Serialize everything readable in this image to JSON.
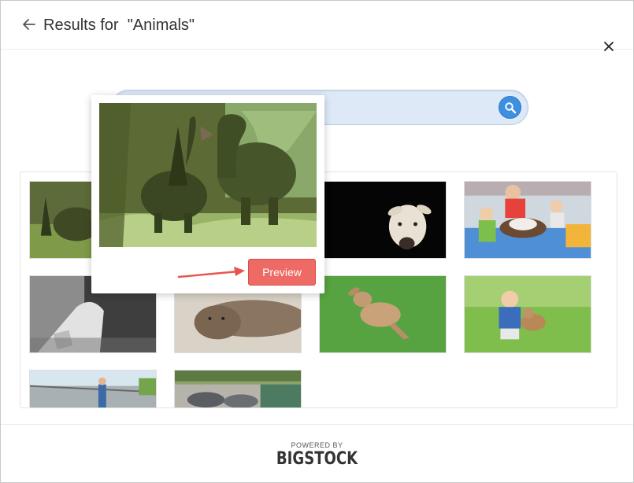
{
  "header": {
    "title": "Results for  \"Animals\"",
    "back_icon": "back-arrow-icon",
    "close_icon": "close-icon"
  },
  "search": {
    "value": "",
    "button_icon": "search-icon"
  },
  "results": {
    "thumbnails": [
      {
        "subject": "topiary-animals"
      },
      {
        "subject": "topiary-animals"
      },
      {
        "subject": "llama"
      },
      {
        "subject": "children-with-dog"
      },
      {
        "subject": "paw-black-white"
      },
      {
        "subject": "sea-lion"
      },
      {
        "subject": "fawn-on-grass"
      },
      {
        "subject": "boy-with-dog"
      },
      {
        "subject": "zoo-worker"
      },
      {
        "subject": "seals-at-pool"
      }
    ]
  },
  "popover": {
    "preview_label": "Preview"
  },
  "footer": {
    "powered_by": "POWERED BY",
    "brand": "BIGSTOCK"
  },
  "colors": {
    "accent": "#3d8fe0",
    "preview": "#ee6a64",
    "arrow": "#e8554f",
    "search_bg": "#dde9f7"
  }
}
